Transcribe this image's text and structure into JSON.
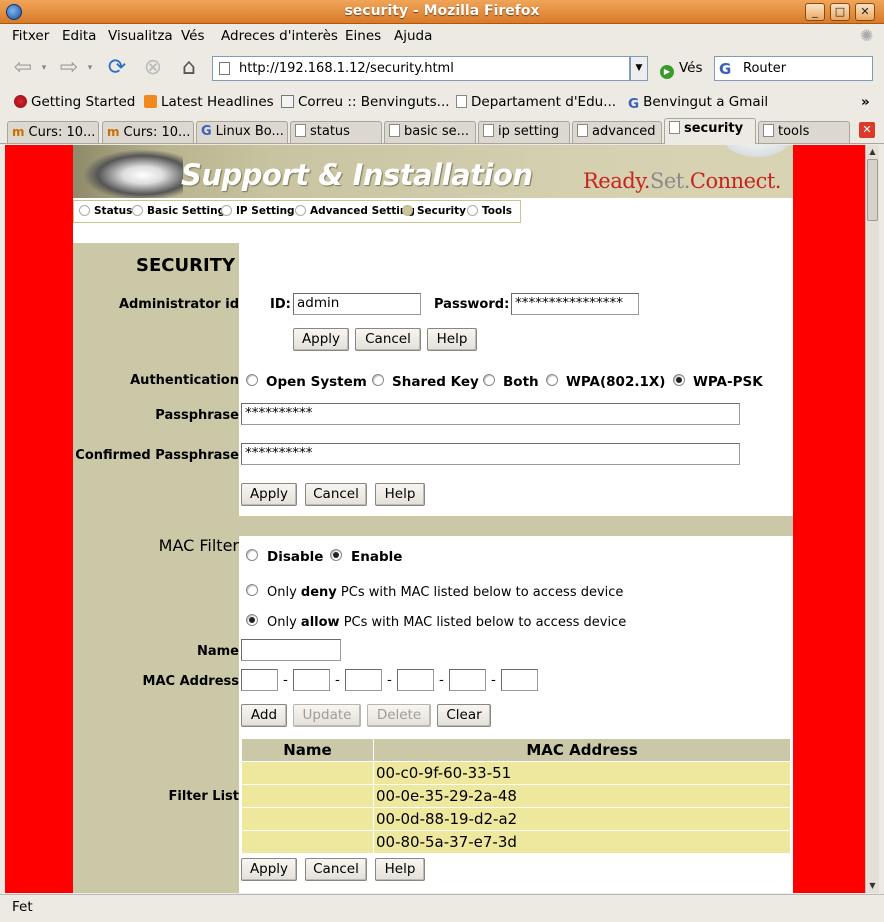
{
  "window": {
    "title": "security - Mozilla Firefox"
  },
  "menu": [
    "Fitxer",
    "Edita",
    "Visualitza",
    "Vés",
    "Adreces d'interès",
    "Eines",
    "Ajuda"
  ],
  "nav": {
    "url": "http://192.168.1.12/security.html",
    "go_label": "Vés",
    "search_value": "Router"
  },
  "bookmarks": [
    "Getting Started",
    "Latest Headlines",
    "Correu :: Benvinguts...",
    "Departament d'Edu...",
    "Benvingut a Gmail"
  ],
  "tabs": [
    {
      "label": "Curs: 10..."
    },
    {
      "label": "Curs: 10..."
    },
    {
      "label": "Linux Bo..."
    },
    {
      "label": "status"
    },
    {
      "label": "basic se..."
    },
    {
      "label": "ip setting"
    },
    {
      "label": "advanced"
    },
    {
      "label": "security"
    },
    {
      "label": "tools"
    }
  ],
  "banner": {
    "title": "Support & Installation",
    "brand_ready": "Ready.",
    "brand_set": "Set.",
    "brand_connect": "Connect."
  },
  "page_nav": [
    "Status",
    "Basic Setting",
    "IP Setting",
    "Advanced Setting",
    "Security",
    "Tools"
  ],
  "security": {
    "heading": "SECURITY",
    "admin_label": "Administrator id",
    "id_label": "ID:",
    "id_value": "admin",
    "password_label": "Password:",
    "password_value": "****************",
    "apply": "Apply",
    "cancel": "Cancel",
    "help": "Help",
    "auth_label": "Authentication",
    "auth_options": [
      "Open System",
      "Shared Key",
      "Both",
      "WPA(802.1X)",
      "WPA-PSK"
    ],
    "auth_selected": "WPA-PSK",
    "passphrase_label": "Passphrase",
    "passphrase_value": "**********",
    "confirm_label": "Confirmed Passphrase",
    "confirm_value": "**********"
  },
  "mac_filter": {
    "heading": "MAC Filter",
    "disable": "Disable",
    "enable": "Enable",
    "selected": "Enable",
    "deny_pre": "Only",
    "deny_word": "deny",
    "deny_post": "PCs with MAC listed below to access device",
    "allow_pre": "Only",
    "allow_word": "allow",
    "allow_post": "PCs with MAC listed below to access device",
    "mode_selected": "allow",
    "name_label": "Name",
    "mac_label": "MAC Address",
    "add": "Add",
    "update": "Update",
    "delete": "Delete",
    "clear": "Clear",
    "filter_list_label": "Filter List",
    "columns": [
      "Name",
      "MAC Address"
    ],
    "rows": [
      {
        "name": "",
        "mac": "00-c0-9f-60-33-51"
      },
      {
        "name": "",
        "mac": "00-0e-35-29-2a-48"
      },
      {
        "name": "",
        "mac": "00-0d-88-19-d2-a2"
      },
      {
        "name": "",
        "mac": "00-80-5a-37-e7-3d"
      }
    ],
    "apply": "Apply",
    "cancel": "Cancel",
    "help": "Help"
  },
  "status": "Fet"
}
